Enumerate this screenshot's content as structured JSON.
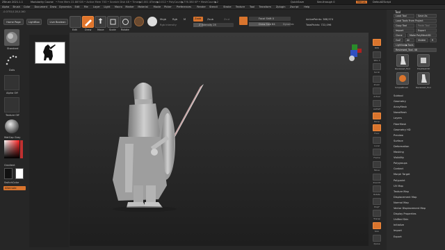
{
  "titlebar": {
    "app": "ZBrush 2021.1.1",
    "project": "Modularity Course",
    "stats": "• Free Mem 22.887GB • Active Mem 703 • Scratch Disk 48 • Timer▶0.001 ATime▶0.012 • PolyCount▶776.380 KP • MeshCount▶2",
    "quicksave": "QuickSave",
    "seethrough": "See-through 0",
    "menus": "Menus",
    "script": "DefaultZScript"
  },
  "menubar": [
    "Alpha",
    "Brush",
    "Color",
    "Document",
    "Draw",
    "Dynamics",
    "Edit",
    "File",
    "Layer",
    "Light",
    "Macro",
    "Marker",
    "Material",
    "Movie",
    "Picker",
    "Preferences",
    "Render",
    "Stencil",
    "Stroke",
    "Texture",
    "Tool",
    "Transform",
    "Zplugin",
    "Zscript",
    "Help"
  ],
  "infobar": "-0.0753,0.28,0.160",
  "left_shelf": {
    "home_page": "Home Page",
    "lightbox": "LightBox",
    "live_boolean": "Live Boolean",
    "brush_label": "Standard",
    "stroke_label": "Dots",
    "alpha_label": "Alpha Off",
    "texture_label": "Texture Off",
    "material_label": "MatCap Gray",
    "gradient_label": "Gradient",
    "switch_color": "SwitchColor",
    "alternate": "Alternate"
  },
  "top_toolbar": {
    "edit": "Edit",
    "draw": "Draw",
    "move": "Move",
    "scale": "Scale",
    "rotate": "Rotate",
    "mrgb": "Mrgb",
    "rgb": "Rgb",
    "m": "M",
    "zadd": "Zadd",
    "zsub": "Zsub",
    "zcut": "Zcut",
    "rgb_intensity": "Rgb Intensity",
    "z_intensity": "Z Intensity 25",
    "focal_shift": "Focal Shift 0",
    "draw_size": "Draw Size 64",
    "dynamic": "Dynamic",
    "active_points": "ActivePoints: 388,974",
    "total_points": "TotalPoints: 722,096"
  },
  "right_panel": {
    "tool_title": "Tool",
    "load_tool": "Load Tool",
    "save_as": "Save As",
    "load_tools_from_project": "Load Tools From Project",
    "copy_tool": "Copy Tool",
    "paste_tool": "Paste Tool",
    "import": "Import",
    "export": "Export",
    "clone": "Clone",
    "make_polymesh": "Make PolyMesh3D",
    "goz": "GoZ",
    "all": "All",
    "visible": "Visible",
    "r": "R",
    "lightbox_tools": "Lightbox▶Tools",
    "current_tool": "Reviewed_Tool. 48",
    "thumbs": [
      "Reviewed_Tool",
      "PolyMesh3D",
      "SimpleBrush",
      "Reviewed_Tool"
    ],
    "subpalettes": [
      "Subtool",
      "Geometry",
      "ArrayMesh",
      "NanoMesh",
      "Layers",
      "FiberMesh",
      "Geometry HD",
      "Preview",
      "Surface",
      "Deformation",
      "Masking",
      "Visibility",
      "Polygroups",
      "Contact",
      "Morph Target",
      "Polypaint",
      "UV Map",
      "Texture Map",
      "Displacement Map",
      "Normal Map",
      "Vector Displacement Map",
      "Display Properties",
      "Unified Skin",
      "Initialize",
      "Import",
      "Export"
    ]
  },
  "tool_strip": [
    "BPR",
    "SPix 3",
    "Scroll",
    "Zoom",
    "Actual",
    "AAHalf",
    "Persp",
    "Floor",
    "Local",
    "Frame",
    "Move",
    "ZoomD",
    "Rotate",
    "PolyF",
    "Transp",
    "Solo",
    "Xpose"
  ],
  "colors": {
    "accent": "#e0752c",
    "panel": "#2b2b2b",
    "background": "#262626"
  }
}
